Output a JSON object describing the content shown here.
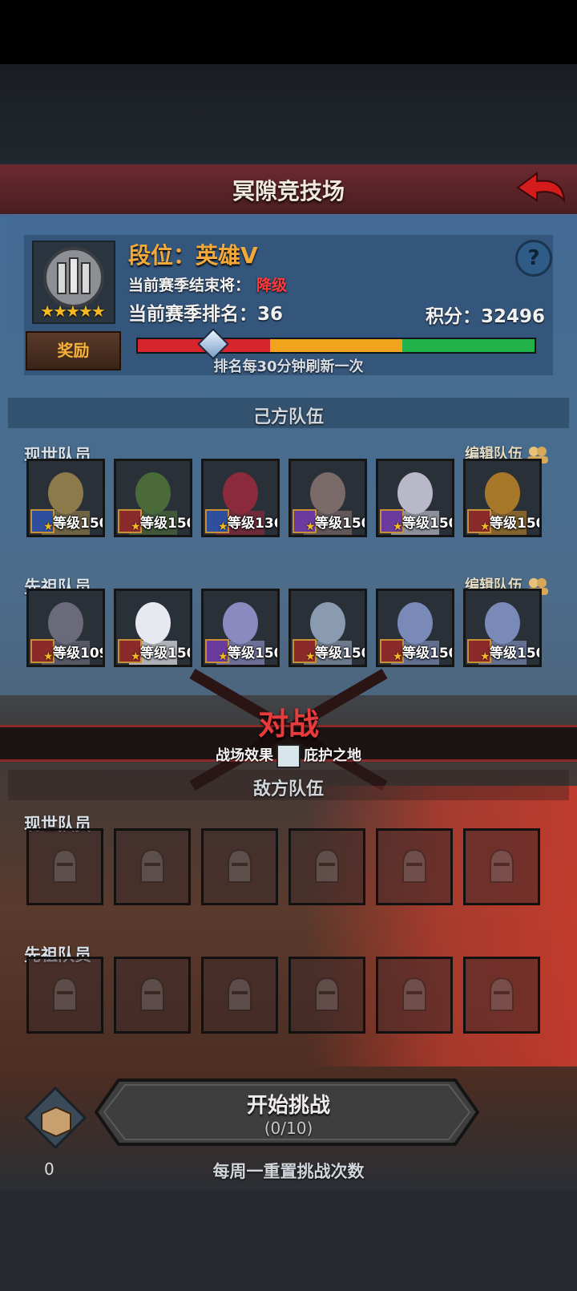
{
  "header": {
    "title": "冥隙竞技场"
  },
  "profile": {
    "rank_title": "段位：英雄Ⅴ",
    "stars": "★★★★★",
    "season_end_label": "当前赛季结束将：",
    "season_end_value": "降级",
    "season_rank": "当前赛季排名：36",
    "score": "积分：32496",
    "reward_button": "奖励",
    "help": "?",
    "refresh_note": "排名每30分钟刷新一次"
  },
  "colors": {
    "bar_red": "#d8242c",
    "bar_yellow": "#f0a41e",
    "bar_green": "#22b24a",
    "accent_orange": "#f3a93a",
    "battle_red": "#e83b3b"
  },
  "my_team": {
    "title": "己方队伍",
    "present_label": "现世队员",
    "ancestor_label": "先祖队员",
    "edit_label": "编辑队伍",
    "present": [
      {
        "level": "等级150",
        "class": "sword",
        "portrait": "bearded-warrior"
      },
      {
        "level": "等级150",
        "class": "beast",
        "portrait": "wreath-ranger"
      },
      {
        "level": "等级136",
        "class": "sword",
        "portrait": "bird-creature"
      },
      {
        "level": "等级150",
        "class": "staff",
        "portrait": "hooded-old-man"
      },
      {
        "level": "等级150",
        "class": "staff",
        "portrait": "elf-mage"
      },
      {
        "level": "等级150",
        "class": "beast",
        "portrait": "golden-helm-knight"
      }
    ],
    "ancestors": [
      {
        "level": "等级109",
        "class": "beast",
        "portrait": "horned-helm"
      },
      {
        "level": "等级150",
        "class": "beast",
        "portrait": "snowman"
      },
      {
        "level": "等级150",
        "class": "staff",
        "portrait": "ghost-witch"
      },
      {
        "level": "等级150",
        "class": "beast",
        "portrait": "pale-elder"
      },
      {
        "level": "等级150",
        "class": "beast",
        "portrait": "pale-bearded-elder"
      },
      {
        "level": "等级150",
        "class": "beast",
        "portrait": "pale-bearded-elder"
      }
    ]
  },
  "battle": {
    "title": "对战",
    "field_label": "战场效果",
    "field_value": "庇护之地"
  },
  "enemy_team": {
    "title": "敌方队伍",
    "present_label": "现世队员",
    "ancestor_label": "先祖队员"
  },
  "actions": {
    "start_label": "开始挑战",
    "start_count": "(0/10)",
    "bag_count": "0",
    "weekly_note": "每周一重置挑战次数"
  }
}
